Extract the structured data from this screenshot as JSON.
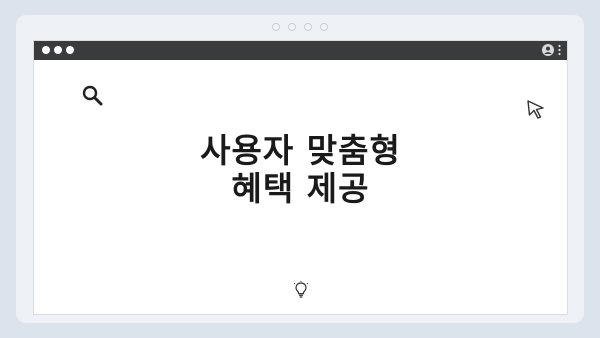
{
  "headline": {
    "line1": "사용자 맞춤형",
    "line2": "혜택 제공"
  },
  "icons": {
    "search": "search-icon",
    "cursor": "cursor-icon",
    "bulb": "lightbulb-icon",
    "profile": "profile-icon",
    "menu": "menu-icon"
  },
  "colors": {
    "background": "#dbe3ec",
    "titlebar": "#3a3b3d",
    "text": "#1a1a1a"
  }
}
